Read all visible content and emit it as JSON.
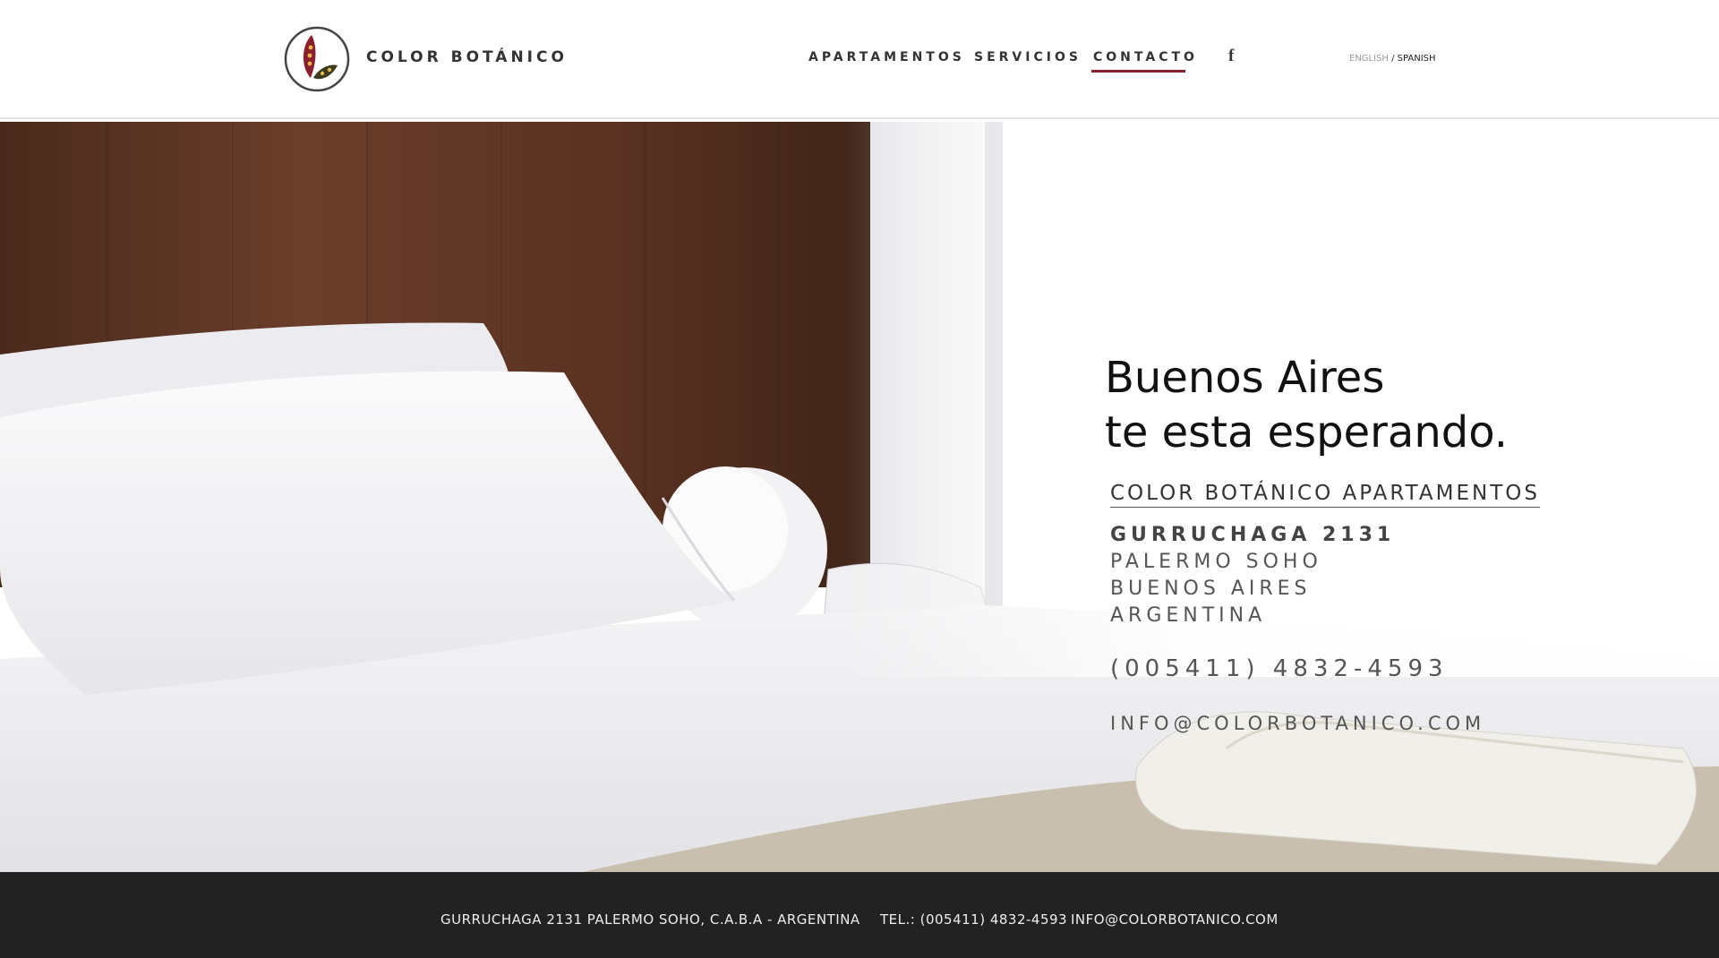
{
  "brand": {
    "name": "COLOR BOTÁNICO"
  },
  "nav": {
    "items": [
      {
        "label": "APARTAMENTOS"
      },
      {
        "label": "SERVICIOS"
      },
      {
        "label": "CONTACTO"
      }
    ],
    "active": "CONTACTO",
    "social_icon": "facebook-icon"
  },
  "language": {
    "english": "ENGLISH",
    "separator": " / ",
    "spanish": "SPANISH"
  },
  "hero": {
    "title_line1": "Buenos Aires",
    "title_line2": "te esta esperando.",
    "subtitle": "COLOR BOTÁNICO APARTAMENTOS",
    "address": {
      "street": "GURRUCHAGA 2131",
      "neighborhood": "PALERMO SOHO",
      "city": "BUENOS AIRES",
      "country": "ARGENTINA"
    },
    "phone": "(005411) 4832-4593",
    "email": "INFO@COLORBOTANICO.COM"
  },
  "footer": {
    "address": "GURRUCHAGA 2131  PALERMO SOHO, C.A.B.A  - ARGENTINA",
    "phone": "TEL.: (005411) 4832-4593",
    "email": "INFO@COLORBOTANICO.COM"
  },
  "colors": {
    "accent": "#8c1f2d",
    "footer_bg": "#222222",
    "text_dark": "#333333"
  }
}
